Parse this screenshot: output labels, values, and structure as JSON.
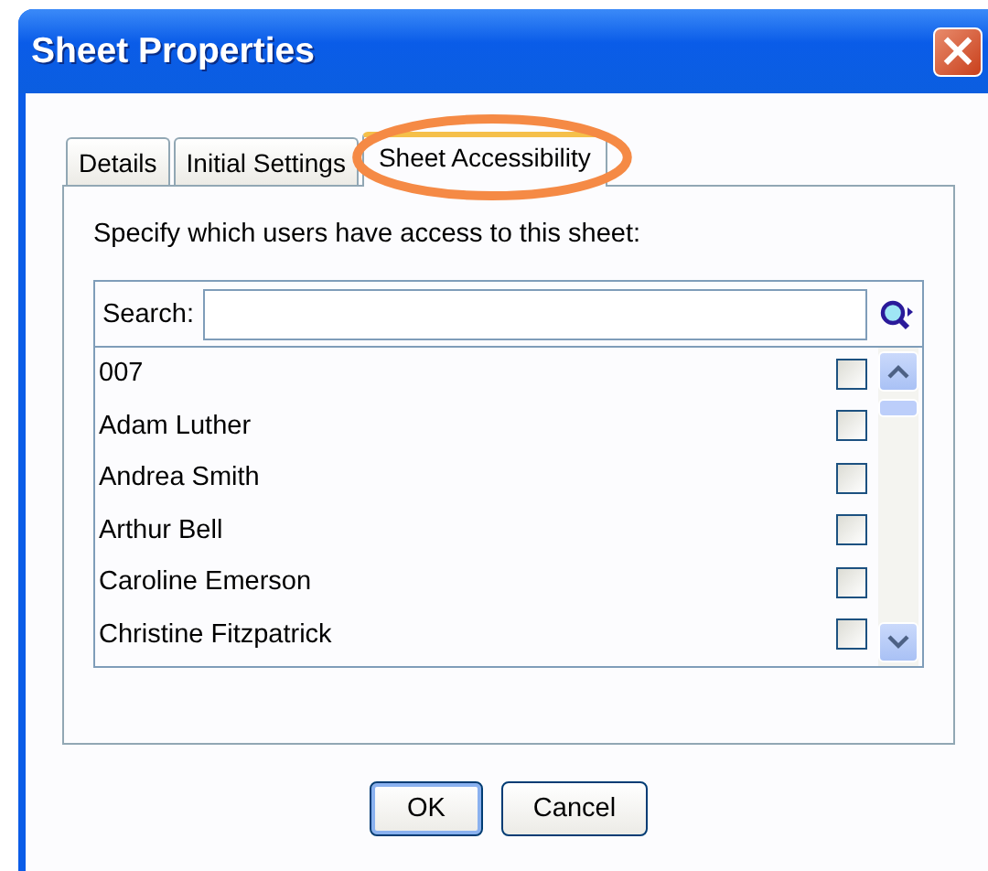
{
  "window": {
    "title": "Sheet Properties",
    "close": "×"
  },
  "tabs": [
    {
      "label": "Details",
      "selected": false,
      "circled": false
    },
    {
      "label": "Initial Settings",
      "selected": false,
      "circled": false
    },
    {
      "label": "Sheet Accessibility",
      "selected": true,
      "circled": true
    }
  ],
  "instruction": "Specify which users have access to this sheet:",
  "search": {
    "label": "Search:"
  },
  "users": [
    {
      "name": "007",
      "checked": false
    },
    {
      "name": "Adam Luther",
      "checked": false
    },
    {
      "name": "Andrea Smith",
      "checked": false
    },
    {
      "name": "Arthur Bell",
      "checked": false
    },
    {
      "name": "Caroline Emerson",
      "checked": false
    },
    {
      "name": "Christine Fitzpatrick",
      "checked": false
    }
  ],
  "buttons": [
    {
      "label": "OK",
      "default": true
    },
    {
      "label": "Cancel",
      "default": false
    }
  ]
}
